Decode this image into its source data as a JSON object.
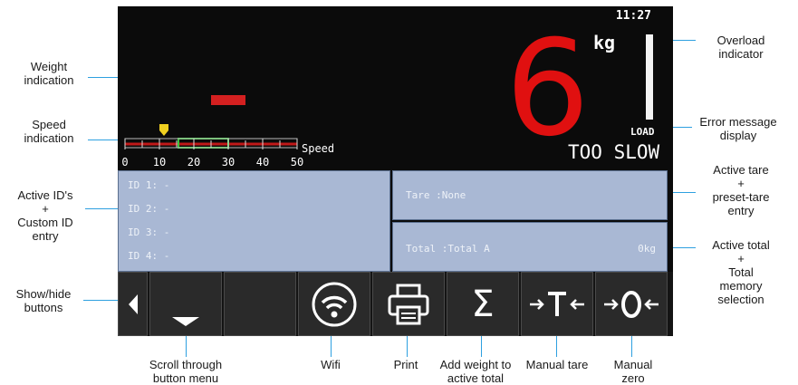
{
  "screen": {
    "time": "11:27",
    "unit": "kg",
    "weight_value": "6",
    "load_label": "LOAD",
    "error_message": "TOO SLOW",
    "speed_label": "Speed",
    "speed_ticks": [
      "0",
      "10",
      "20",
      "30",
      "40",
      "50"
    ],
    "ids": [
      "ID 1: -",
      "ID 2: -",
      "ID 3: -",
      "ID 4: -"
    ],
    "tare_text": "Tare  :None",
    "total_text": "Total :Total A",
    "total_value": "0kg"
  },
  "buttons": {
    "sigma": "Σ"
  },
  "annotations": {
    "weight_indication": "Weight indication",
    "speed_indication": "Speed indication",
    "active_ids": [
      "Active ID's",
      "+",
      "Custom ID",
      "entry"
    ],
    "show_hide": "Show/hide buttons",
    "overload_indicator": "Overload indicator",
    "error_message_display": "Error message display",
    "active_tare": [
      "Active tare",
      "+",
      "preset-tare",
      "entry"
    ],
    "active_total": [
      "Active total",
      "+",
      "Total",
      "memory",
      "selection"
    ],
    "scroll": "Scroll through button menu",
    "wifi": "Wifi",
    "print": "Print",
    "add_weight": "Add weight to active total",
    "manual_tare": "Manual tare",
    "manual_zero": "Manual zero"
  },
  "colors": {
    "weight_red": "#e01010",
    "panel_blue": "#a9b8d4",
    "leader_blue": "#2ea0e0",
    "speed_green": "#3ec43e",
    "speed_red": "#c01818",
    "speed_marker": "#f0d020"
  },
  "icons": [
    "chevron-left-icon",
    "scroll-down-icon",
    "wifi-icon",
    "printer-icon",
    "sigma-icon",
    "tare-icon",
    "zero-icon"
  ]
}
